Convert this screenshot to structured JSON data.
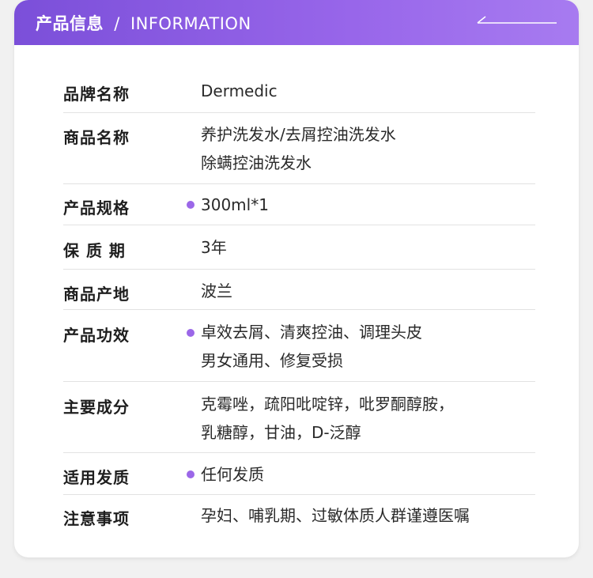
{
  "header": {
    "title_cn": "产品信息",
    "separator": "/",
    "title_en": "INFORMATION"
  },
  "colors": {
    "accent": "#9b67e8",
    "header_gradient_start": "#7b4fd9",
    "header_gradient_end": "#a77bf0"
  },
  "rows": [
    {
      "label": "品牌名称",
      "lines": [
        "Dermedic"
      ],
      "bullet": false
    },
    {
      "label": "商品名称",
      "lines": [
        "养护洗发水/去屑控油洗发水",
        "除螨控油洗发水"
      ],
      "bullet": false
    },
    {
      "label": "产品规格",
      "lines": [
        "300ml*1"
      ],
      "bullet": true
    },
    {
      "label": "保 质 期",
      "lines": [
        "3年"
      ],
      "bullet": false
    },
    {
      "label": "商品产地",
      "lines": [
        "波兰"
      ],
      "bullet": false
    },
    {
      "label": "产品功效",
      "lines": [
        "卓效去屑、清爽控油、调理头皮",
        "男女通用、修复受损"
      ],
      "bullet": true
    },
    {
      "label": "主要成分",
      "lines": [
        "克霉唑，疏阳吡啶锌，吡罗酮醇胺，",
        "乳糖醇，甘油，D-泛醇"
      ],
      "bullet": false
    },
    {
      "label": "适用发质",
      "lines": [
        "任何发质"
      ],
      "bullet": true
    },
    {
      "label": "注意事项",
      "lines": [
        "孕妇、哺乳期、过敏体质人群谨遵医嘱"
      ],
      "bullet": false
    }
  ]
}
